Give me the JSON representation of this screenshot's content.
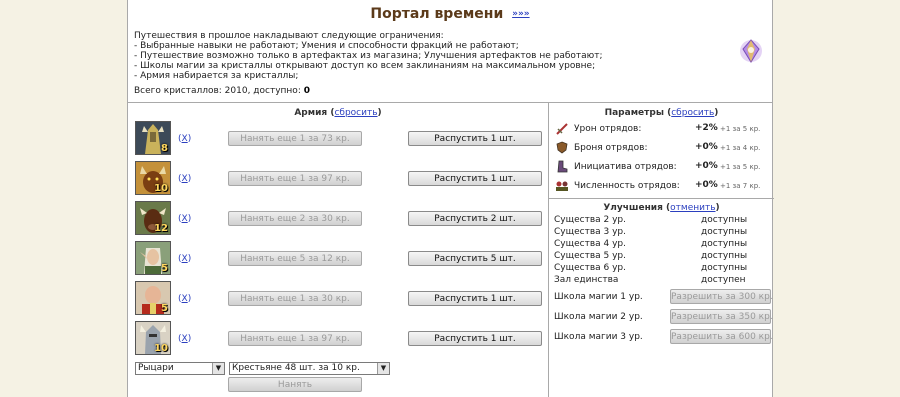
{
  "page": {
    "title": "Портал времени",
    "more_link": "»»»",
    "intro": [
      "Путешествия в прошлое накладывают следующие ограничения:",
      "- Выбранные навыки не работают; Умения и способности фракций не работают;",
      "- Путешествие возможно только в артефактах из магазина; Улучшения артефактов не работают;",
      "- Школы магии за кристаллы открывают доступ ко всем заклинаниям на максимальном уровне;",
      "- Армия набирается за кристаллы;"
    ],
    "crystals_label": "Всего кристаллов: 2010, доступно:",
    "crystals_available": "0"
  },
  "army": {
    "title": "Армия",
    "reset_open": "(",
    "reset_link": "сбросить",
    "reset_close": ")",
    "x_open": "(",
    "x_label": "X",
    "x_close": ")",
    "units": [
      {
        "count": "8",
        "hire_label": "Нанять еще 1 за 73 кр.",
        "dismiss_label": "Распустить 1 шт.",
        "portrait": "armored-warrior-portrait"
      },
      {
        "count": "10",
        "hire_label": "Нанять еще 1 за 97 кр.",
        "dismiss_label": "Распустить 1 шт.",
        "portrait": "horned-beast-portrait"
      },
      {
        "count": "12",
        "hire_label": "Нанять еще 2 за 30 кр.",
        "dismiss_label": "Распустить 2 шт.",
        "portrait": "minotaur-portrait"
      },
      {
        "count": "5",
        "hire_label": "Нанять еще 5 за 12 кр.",
        "dismiss_label": "Распустить 5 шт.",
        "portrait": "elf-portrait"
      },
      {
        "count": "5",
        "hire_label": "Нанять еще 1 за 30 кр.",
        "dismiss_label": "Распустить 1 шт.",
        "portrait": "bald-monk-portrait"
      },
      {
        "count": "10",
        "hire_label": "Нанять еще 1 за 97 кр.",
        "dismiss_label": "Распустить 1 шт.",
        "portrait": "paladin-portrait"
      }
    ],
    "faction_select": "Рыцари",
    "unit_select": "Крестьяне 48 шт. за 10 кр.",
    "hire_button": "Нанять"
  },
  "params": {
    "title": "Параметры",
    "reset_open": "(",
    "reset_link": "сбросить",
    "reset_close": ")",
    "rows": [
      {
        "icon": "sword-icon",
        "label": "Урон отрядов:",
        "value": "+2%",
        "cost": "+1 за 5 кр."
      },
      {
        "icon": "shield-icon",
        "label": "Броня отрядов:",
        "value": "+0%",
        "cost": "+1 за 4 кр."
      },
      {
        "icon": "boot-icon",
        "label": "Инициатива отрядов:",
        "value": "+0%",
        "cost": "+1 за 5 кр."
      },
      {
        "icon": "troops-icon",
        "label": "Численность отрядов:",
        "value": "+0%",
        "cost": "+1 за 7 кр."
      }
    ]
  },
  "upgrades": {
    "title": "Улучшения",
    "cancel_open": "(",
    "cancel_link": "отменить",
    "cancel_close": ")",
    "rows": [
      {
        "label": "Существа 2 ур.",
        "status": "доступны"
      },
      {
        "label": "Существа 3 ур.",
        "status": "доступны"
      },
      {
        "label": "Существа 4 ур.",
        "status": "доступны"
      },
      {
        "label": "Существа 5 ур.",
        "status": "доступны"
      },
      {
        "label": "Существа 6 ур.",
        "status": "доступны"
      },
      {
        "label": "Зал единства",
        "status": "доступен"
      }
    ],
    "magic": [
      {
        "label": "Школа магии 1 ур.",
        "button": "Разрешить за 300 кр."
      },
      {
        "label": "Школа магии 2 ур.",
        "button": "Разрешить за 350 кр."
      },
      {
        "label": "Школа магии 3 ур.",
        "button": "Разрешить за 600 кр."
      }
    ]
  },
  "colors": {
    "title": "#5b3a1a",
    "link": "#2b3fbf",
    "background": "#f5f2e4",
    "border": "#a9a9a9"
  }
}
